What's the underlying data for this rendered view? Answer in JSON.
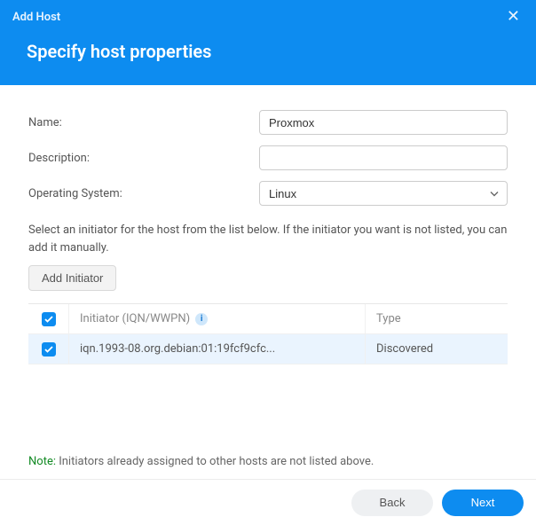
{
  "window": {
    "title": "Add Host"
  },
  "heading": "Specify host properties",
  "form": {
    "name_label": "Name:",
    "name_value": "Proxmox",
    "description_label": "Description:",
    "description_value": "",
    "os_label": "Operating System:",
    "os_value": "Linux"
  },
  "instructions": "Select an initiator for the host from the list below. If the initiator you want is not listed, you can add it manually.",
  "buttons": {
    "add_initiator": "Add Initiator",
    "back": "Back",
    "next": "Next"
  },
  "table": {
    "header_initiator": "Initiator (IQN/WWPN)",
    "header_type": "Type",
    "rows": [
      {
        "checked": true,
        "initiator": "iqn.1993-08.org.debian:01:19fcf9cfc...",
        "type": "Discovered"
      }
    ]
  },
  "note": {
    "label": "Note:",
    "text": "Initiators already assigned to other hosts are not listed above."
  }
}
